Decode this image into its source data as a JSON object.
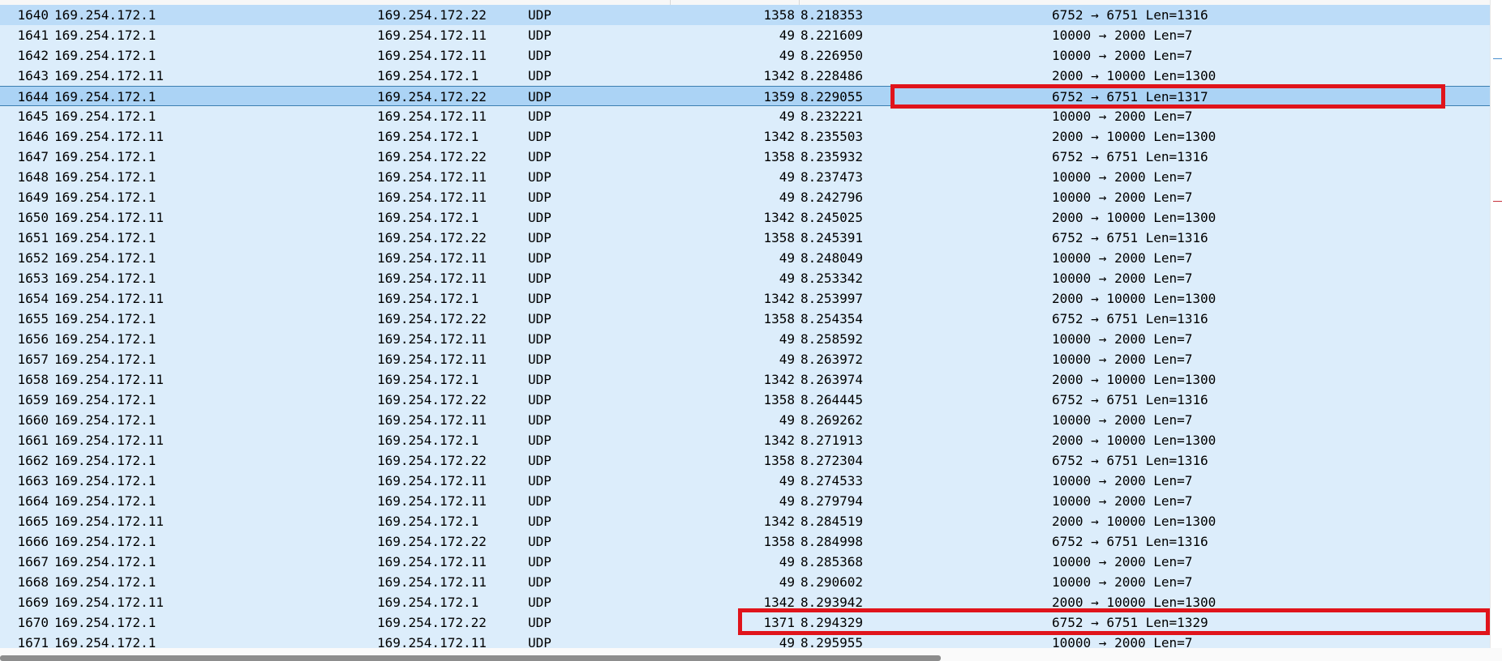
{
  "packets": [
    {
      "no": "1640",
      "src": "169.254.172.1",
      "dst": "169.254.172.22",
      "proto": "UDP",
      "len": "1358",
      "time": "8.218353",
      "info": "6752 → 6751 Len=1316"
    },
    {
      "no": "1641",
      "src": "169.254.172.1",
      "dst": "169.254.172.11",
      "proto": "UDP",
      "len": "49",
      "time": "8.221609",
      "info": "10000 → 2000 Len=7"
    },
    {
      "no": "1642",
      "src": "169.254.172.1",
      "dst": "169.254.172.11",
      "proto": "UDP",
      "len": "49",
      "time": "8.226950",
      "info": "10000 → 2000 Len=7"
    },
    {
      "no": "1643",
      "src": "169.254.172.11",
      "dst": "169.254.172.1",
      "proto": "UDP",
      "len": "1342",
      "time": "8.228486",
      "info": "2000 → 10000 Len=1300"
    },
    {
      "no": "1644",
      "src": "169.254.172.1",
      "dst": "169.254.172.22",
      "proto": "UDP",
      "len": "1359",
      "time": "8.229055",
      "info": "6752 → 6751 Len=1317"
    },
    {
      "no": "1645",
      "src": "169.254.172.1",
      "dst": "169.254.172.11",
      "proto": "UDP",
      "len": "49",
      "time": "8.232221",
      "info": "10000 → 2000 Len=7"
    },
    {
      "no": "1646",
      "src": "169.254.172.11",
      "dst": "169.254.172.1",
      "proto": "UDP",
      "len": "1342",
      "time": "8.235503",
      "info": "2000 → 10000 Len=1300"
    },
    {
      "no": "1647",
      "src": "169.254.172.1",
      "dst": "169.254.172.22",
      "proto": "UDP",
      "len": "1358",
      "time": "8.235932",
      "info": "6752 → 6751 Len=1316"
    },
    {
      "no": "1648",
      "src": "169.254.172.1",
      "dst": "169.254.172.11",
      "proto": "UDP",
      "len": "49",
      "time": "8.237473",
      "info": "10000 → 2000 Len=7"
    },
    {
      "no": "1649",
      "src": "169.254.172.1",
      "dst": "169.254.172.11",
      "proto": "UDP",
      "len": "49",
      "time": "8.242796",
      "info": "10000 → 2000 Len=7"
    },
    {
      "no": "1650",
      "src": "169.254.172.11",
      "dst": "169.254.172.1",
      "proto": "UDP",
      "len": "1342",
      "time": "8.245025",
      "info": "2000 → 10000 Len=1300"
    },
    {
      "no": "1651",
      "src": "169.254.172.1",
      "dst": "169.254.172.22",
      "proto": "UDP",
      "len": "1358",
      "time": "8.245391",
      "info": "6752 → 6751 Len=1316"
    },
    {
      "no": "1652",
      "src": "169.254.172.1",
      "dst": "169.254.172.11",
      "proto": "UDP",
      "len": "49",
      "time": "8.248049",
      "info": "10000 → 2000 Len=7"
    },
    {
      "no": "1653",
      "src": "169.254.172.1",
      "dst": "169.254.172.11",
      "proto": "UDP",
      "len": "49",
      "time": "8.253342",
      "info": "10000 → 2000 Len=7"
    },
    {
      "no": "1654",
      "src": "169.254.172.11",
      "dst": "169.254.172.1",
      "proto": "UDP",
      "len": "1342",
      "time": "8.253997",
      "info": "2000 → 10000 Len=1300"
    },
    {
      "no": "1655",
      "src": "169.254.172.1",
      "dst": "169.254.172.22",
      "proto": "UDP",
      "len": "1358",
      "time": "8.254354",
      "info": "6752 → 6751 Len=1316"
    },
    {
      "no": "1656",
      "src": "169.254.172.1",
      "dst": "169.254.172.11",
      "proto": "UDP",
      "len": "49",
      "time": "8.258592",
      "info": "10000 → 2000 Len=7"
    },
    {
      "no": "1657",
      "src": "169.254.172.1",
      "dst": "169.254.172.11",
      "proto": "UDP",
      "len": "49",
      "time": "8.263972",
      "info": "10000 → 2000 Len=7"
    },
    {
      "no": "1658",
      "src": "169.254.172.11",
      "dst": "169.254.172.1",
      "proto": "UDP",
      "len": "1342",
      "time": "8.263974",
      "info": "2000 → 10000 Len=1300"
    },
    {
      "no": "1659",
      "src": "169.254.172.1",
      "dst": "169.254.172.22",
      "proto": "UDP",
      "len": "1358",
      "time": "8.264445",
      "info": "6752 → 6751 Len=1316"
    },
    {
      "no": "1660",
      "src": "169.254.172.1",
      "dst": "169.254.172.11",
      "proto": "UDP",
      "len": "49",
      "time": "8.269262",
      "info": "10000 → 2000 Len=7"
    },
    {
      "no": "1661",
      "src": "169.254.172.11",
      "dst": "169.254.172.1",
      "proto": "UDP",
      "len": "1342",
      "time": "8.271913",
      "info": "2000 → 10000 Len=1300"
    },
    {
      "no": "1662",
      "src": "169.254.172.1",
      "dst": "169.254.172.22",
      "proto": "UDP",
      "len": "1358",
      "time": "8.272304",
      "info": "6752 → 6751 Len=1316"
    },
    {
      "no": "1663",
      "src": "169.254.172.1",
      "dst": "169.254.172.11",
      "proto": "UDP",
      "len": "49",
      "time": "8.274533",
      "info": "10000 → 2000 Len=7"
    },
    {
      "no": "1664",
      "src": "169.254.172.1",
      "dst": "169.254.172.11",
      "proto": "UDP",
      "len": "49",
      "time": "8.279794",
      "info": "10000 → 2000 Len=7"
    },
    {
      "no": "1665",
      "src": "169.254.172.11",
      "dst": "169.254.172.1",
      "proto": "UDP",
      "len": "1342",
      "time": "8.284519",
      "info": "2000 → 10000 Len=1300"
    },
    {
      "no": "1666",
      "src": "169.254.172.1",
      "dst": "169.254.172.22",
      "proto": "UDP",
      "len": "1358",
      "time": "8.284998",
      "info": "6752 → 6751 Len=1316"
    },
    {
      "no": "1667",
      "src": "169.254.172.1",
      "dst": "169.254.172.11",
      "proto": "UDP",
      "len": "49",
      "time": "8.285368",
      "info": "10000 → 2000 Len=7"
    },
    {
      "no": "1668",
      "src": "169.254.172.1",
      "dst": "169.254.172.11",
      "proto": "UDP",
      "len": "49",
      "time": "8.290602",
      "info": "10000 → 2000 Len=7"
    },
    {
      "no": "1669",
      "src": "169.254.172.11",
      "dst": "169.254.172.1",
      "proto": "UDP",
      "len": "1342",
      "time": "8.293942",
      "info": "2000 → 10000 Len=1300"
    },
    {
      "no": "1670",
      "src": "169.254.172.1",
      "dst": "169.254.172.22",
      "proto": "UDP",
      "len": "1371",
      "time": "8.294329",
      "info": "6752 → 6751 Len=1329"
    },
    {
      "no": "1671",
      "src": "169.254.172.1",
      "dst": "169.254.172.11",
      "proto": "UDP",
      "len": "49",
      "time": "8.295955",
      "info": "10000 → 2000 Len=7"
    }
  ],
  "selected_packet": "1644",
  "hover_packet": "1640",
  "annotated_packets": [
    "1644",
    "1670"
  ],
  "colors": {
    "row_bg": "#dcedfb",
    "row_selected": "#abd3f5",
    "row_hover": "#bcdcf8",
    "annotation_red": "#e0141b",
    "scrollbar_thumb": "#8d8d8d"
  },
  "icons": {
    "minimap_marks": [
      "blue-packet-mark",
      "red-packet-mark"
    ]
  }
}
